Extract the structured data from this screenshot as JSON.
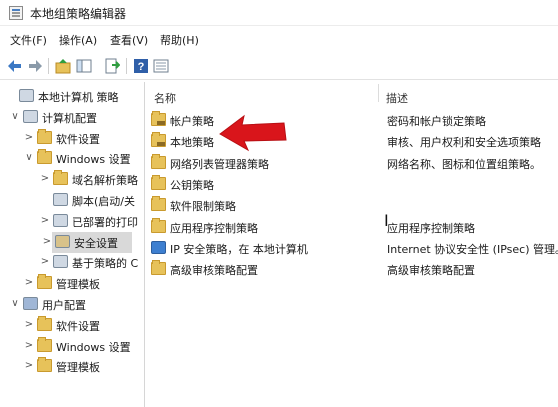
{
  "window": {
    "title": "本地组策略编辑器"
  },
  "menu": [
    "文件(F)",
    "操作(A)",
    "查看(V)",
    "帮助(H)"
  ],
  "tree": {
    "items": [
      {
        "label": "本地计算机 策略",
        "level": 0,
        "expander": "",
        "icon": "computer-policy-icon"
      },
      {
        "label": "计算机配置",
        "level": 1,
        "expander": "∨",
        "icon": "computer-icon"
      },
      {
        "label": "软件设置",
        "level": 2,
        "expander": ">",
        "icon": "folder-icon"
      },
      {
        "label": "Windows 设置",
        "level": 2,
        "expander": "∨",
        "icon": "folder-icon"
      },
      {
        "label": "域名解析策略",
        "level": 3,
        "expander": ">",
        "icon": "folder-icon"
      },
      {
        "label": "脚本(启动/关",
        "level": 3,
        "expander": "",
        "icon": "script-icon"
      },
      {
        "label": "已部署的打印",
        "level": 3,
        "expander": ">",
        "icon": "printer-icon"
      },
      {
        "label": "安全设置",
        "level": 3,
        "expander": ">",
        "icon": "security-icon",
        "selected": true
      },
      {
        "label": "基于策略的 C",
        "level": 3,
        "expander": ">",
        "icon": "chart-icon"
      },
      {
        "label": "管理模板",
        "level": 2,
        "expander": ">",
        "icon": "folder-icon"
      },
      {
        "label": "用户配置",
        "level": 1,
        "expander": "∨",
        "icon": "user-icon"
      },
      {
        "label": "软件设置",
        "level": 2,
        "expander": ">",
        "icon": "folder-icon"
      },
      {
        "label": "Windows 设置",
        "level": 2,
        "expander": ">",
        "icon": "folder-icon"
      },
      {
        "label": "管理模板",
        "level": 2,
        "expander": ">",
        "icon": "folder-icon"
      }
    ]
  },
  "list": {
    "columns": {
      "name": "名称",
      "description": "描述"
    },
    "rows": [
      {
        "name": "帐户策略",
        "description": "密码和帐户锁定策略",
        "icon": "folder-lock-icon"
      },
      {
        "name": "本地策略",
        "description": "审核、用户权利和安全选项策略",
        "icon": "folder-lock-icon"
      },
      {
        "name": "网络列表管理器策略",
        "description": "网络名称、图标和位置组策略。",
        "icon": "folder-icon"
      },
      {
        "name": "公钥策略",
        "description": "",
        "icon": "folder-icon"
      },
      {
        "name": "软件限制策略",
        "description": "",
        "icon": "folder-icon"
      },
      {
        "name": "应用程序控制策略",
        "description": "应用程序控制策略",
        "icon": "folder-icon"
      },
      {
        "name": "IP 安全策略，在 本地计算机",
        "description": "Internet 协议安全性 (IPsec) 管理。",
        "icon": "ipsec-icon"
      },
      {
        "name": "高级审核策略配置",
        "description": "高级审核策略配置",
        "icon": "folder-icon"
      }
    ]
  },
  "colors": {
    "folder": "#e7c25a",
    "arrow": "#d9151b",
    "selection": "#d9d9d9",
    "nav_arrow": "#3b78c4"
  }
}
